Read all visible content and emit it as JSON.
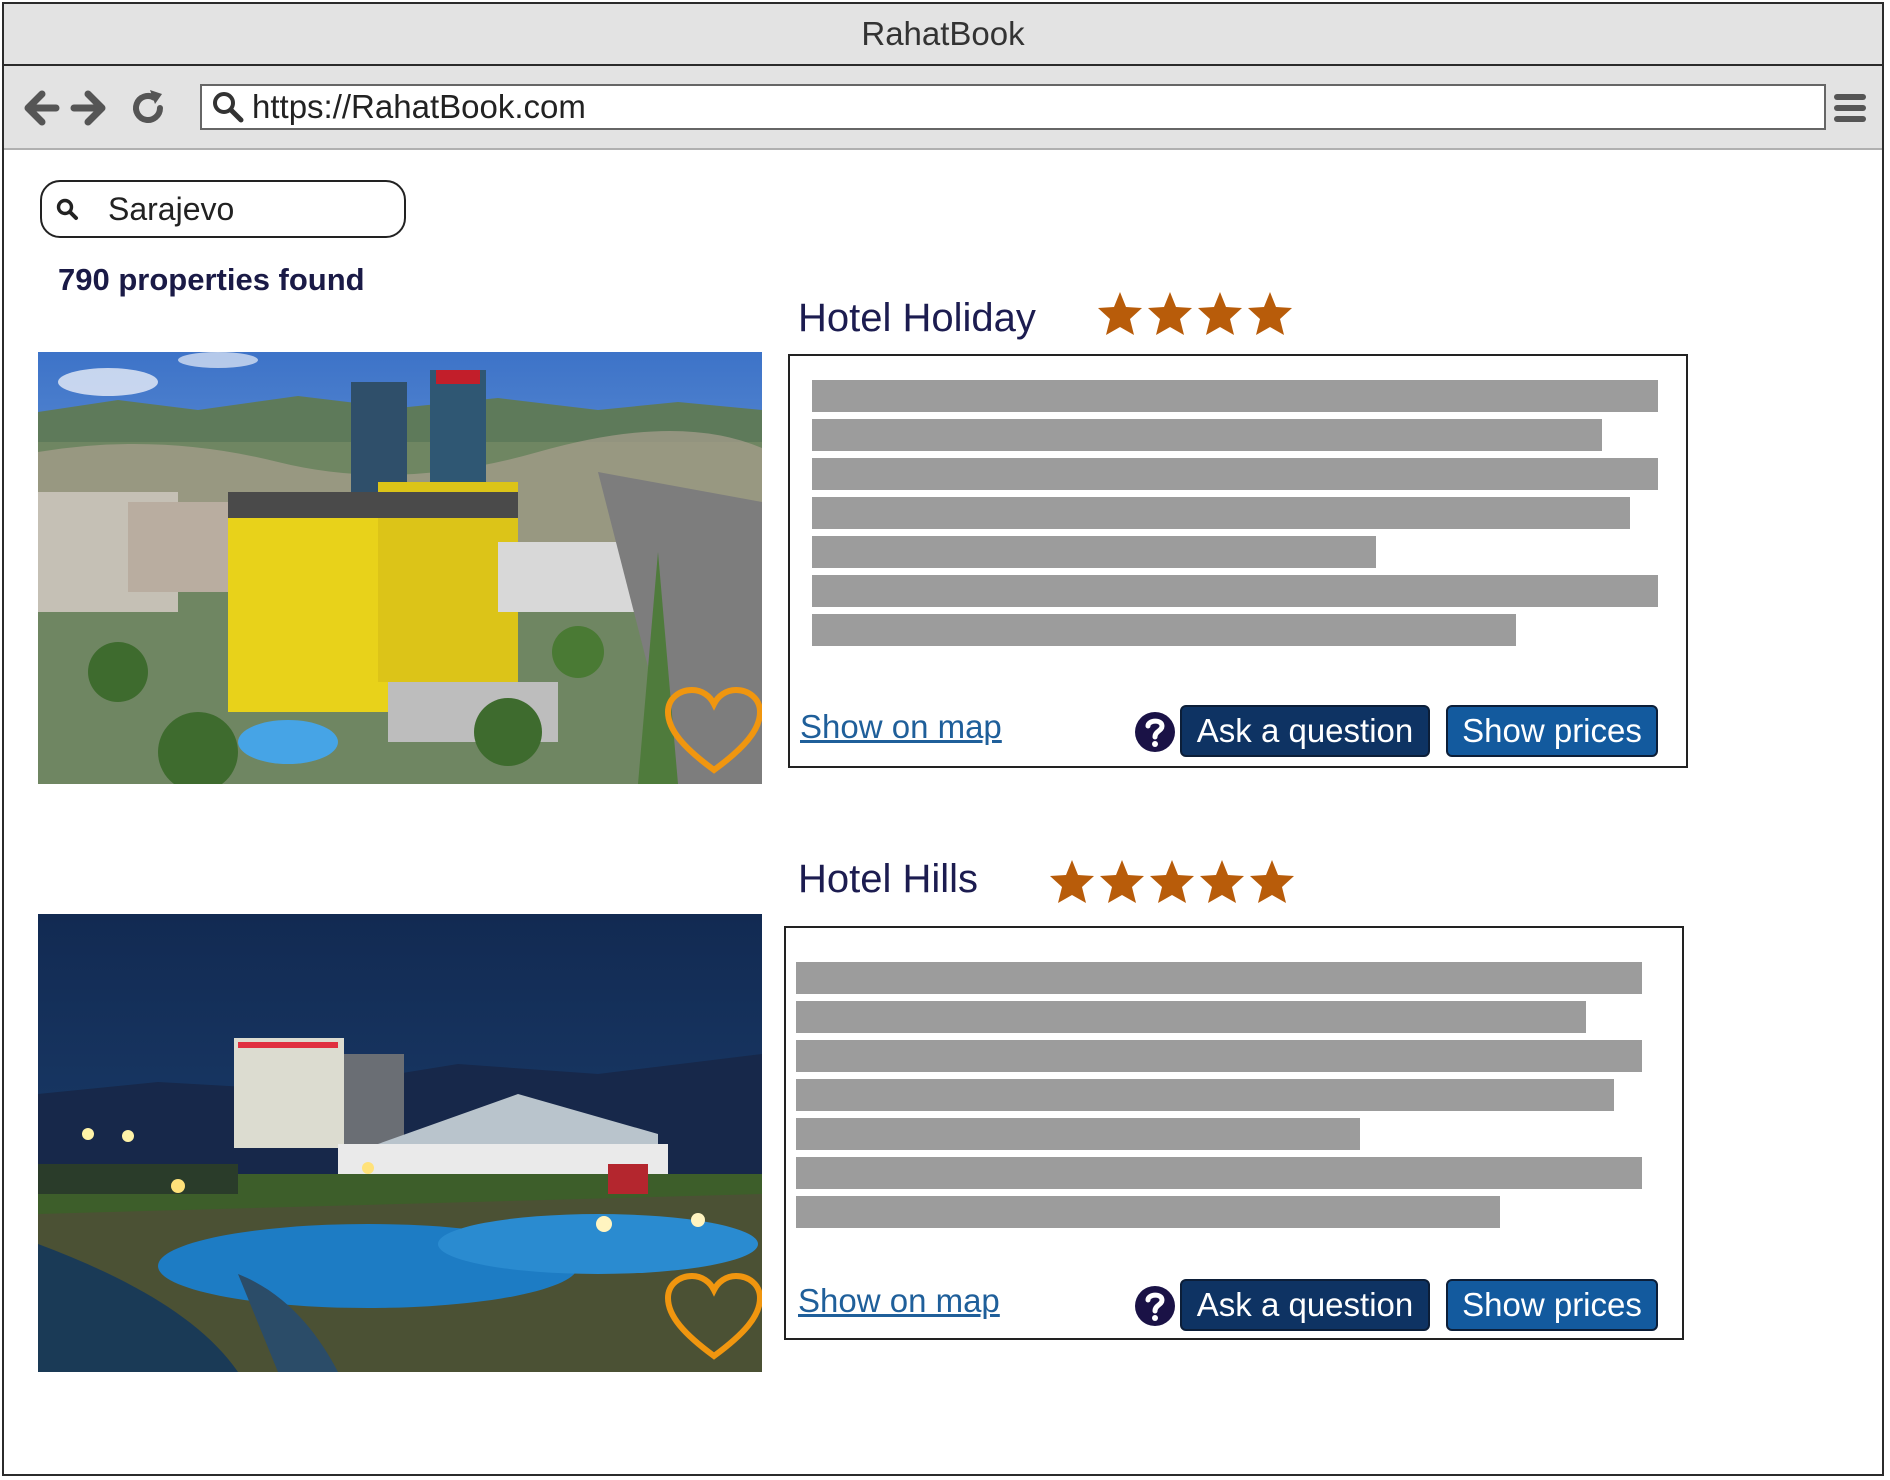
{
  "window": {
    "title": "RahatBook"
  },
  "toolbar": {
    "url": "https://RahatBook.com",
    "icons": [
      "back-icon",
      "forward-icon",
      "reload-icon",
      "search-icon",
      "menu-icon"
    ]
  },
  "search": {
    "value": "Sarajevo"
  },
  "results": {
    "count_text": "790 properties found",
    "hotels": [
      {
        "name": "Hotel Holiday",
        "stars": 4,
        "map_link": "Show on map",
        "ask_label": "Ask a question",
        "prices_label": "Show prices"
      },
      {
        "name": "Hotel Hills",
        "stars": 5,
        "map_link": "Show on map",
        "ask_label": "Ask a question",
        "prices_label": "Show prices"
      }
    ]
  },
  "colors": {
    "star": "#b85c0a",
    "heart": "#f0960f",
    "ask_button": "#0e3363",
    "prices_button": "#135a9e",
    "placeholder_bar": "#9c9c9c"
  }
}
